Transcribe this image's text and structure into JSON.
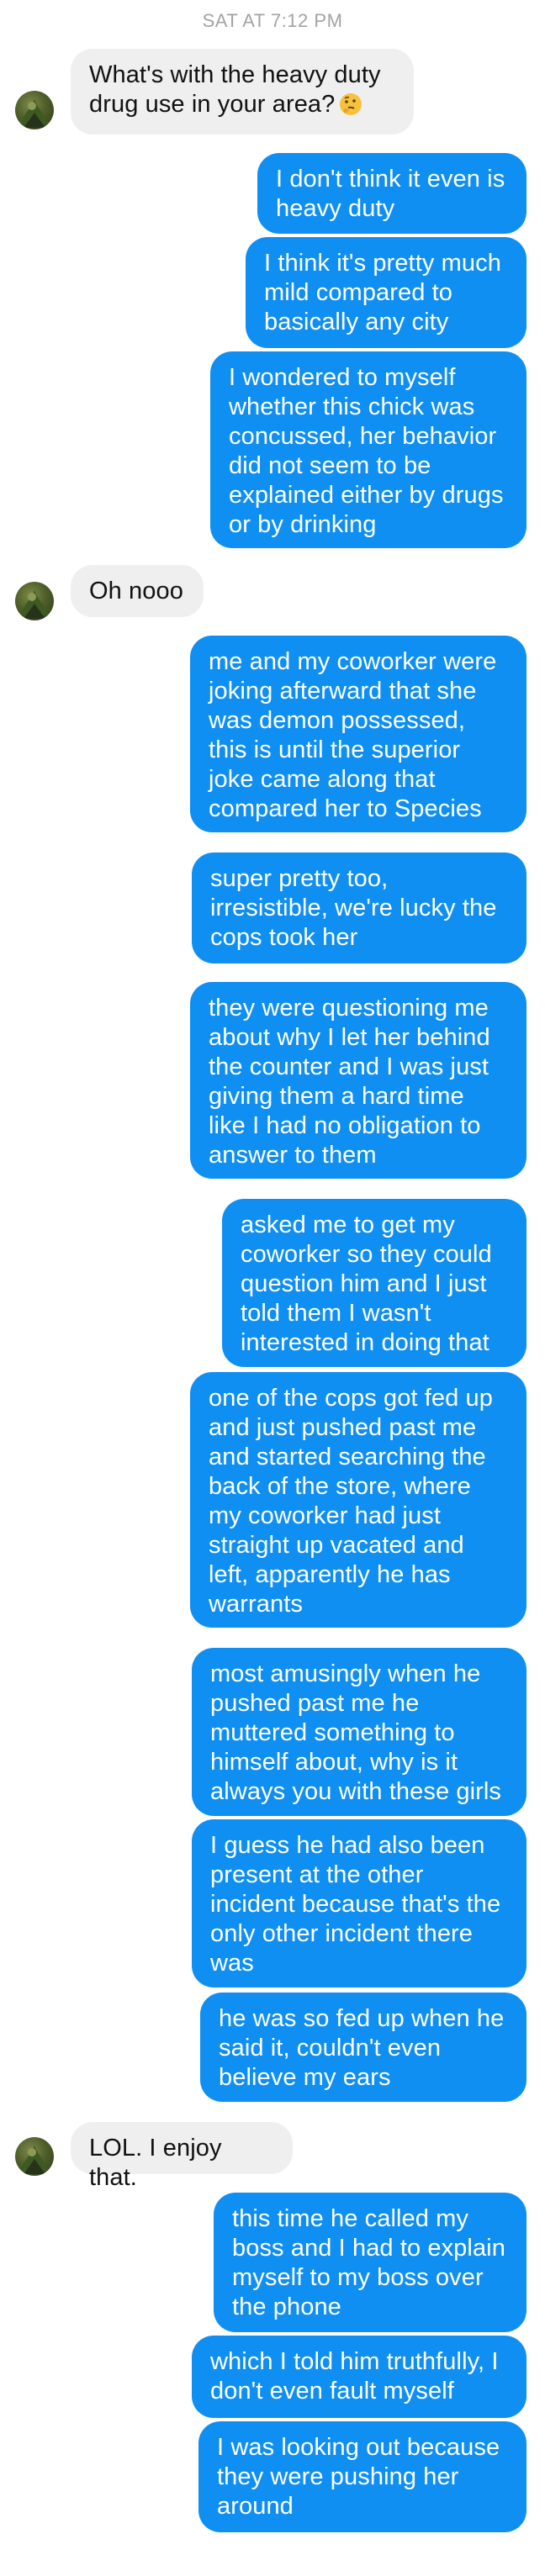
{
  "timestamp": "SAT AT 7:12 PM",
  "colors": {
    "outgoing": "#0f8ff2",
    "incoming": "#efefef"
  },
  "messages": [
    {
      "dir": "in",
      "text": "What's with the heavy duty\ndrug use in your area?",
      "emoji": "thinking-face"
    },
    {
      "dir": "out",
      "text": "I don't think it even is\nheavy duty"
    },
    {
      "dir": "out",
      "text": "I think it's pretty much\nmild compared to\nbasically any city"
    },
    {
      "dir": "out",
      "text": "I wondered to myself\nwhether this chick was\nconcussed, her behavior\ndid not seem to be\nexplained either by drugs\nor by drinking"
    },
    {
      "dir": "in",
      "text": "Oh nooo"
    },
    {
      "dir": "out",
      "text": "me and my coworker were\njoking afterward that she\nwas demon possessed,\nthis is until the superior\njoke came along that\ncompared her to Species"
    },
    {
      "dir": "out",
      "text": "super pretty too,\nirresistible, we're lucky the\ncops took her"
    },
    {
      "dir": "out",
      "text": "they were questioning me\nabout why I let her behind\nthe counter and I was just\ngiving them a hard time\nlike I had no obligation to\nanswer to them"
    },
    {
      "dir": "out",
      "text": "asked me to get my\ncoworker so they could\nquestion him and I just\ntold them I wasn't\ninterested in doing that"
    },
    {
      "dir": "out",
      "text": "one of the cops got fed up\nand just pushed past me\nand started searching the\nback of the store, where\nmy coworker had just\nstraight up vacated and\nleft, apparently he has\nwarrants"
    },
    {
      "dir": "out",
      "text": "most amusingly when he\npushed past me he\nmuttered something to\nhimself about, why is it\nalways you with these girls"
    },
    {
      "dir": "out",
      "text": "I guess he had also been\npresent at the other\nincident because that's the\nonly other incident there\nwas"
    },
    {
      "dir": "out",
      "text": "he was so fed up when he\nsaid it, couldn't even\nbelieve my ears"
    },
    {
      "dir": "in",
      "text": "LOL. I enjoy that."
    },
    {
      "dir": "out",
      "text": "this time he called my\nboss and I had to explain\nmyself to my boss over\nthe phone"
    },
    {
      "dir": "out",
      "text": "which I told him truthfully, I\ndon't even fault myself"
    },
    {
      "dir": "out",
      "text": "I was looking out because\nthey were pushing her\naround"
    }
  ]
}
